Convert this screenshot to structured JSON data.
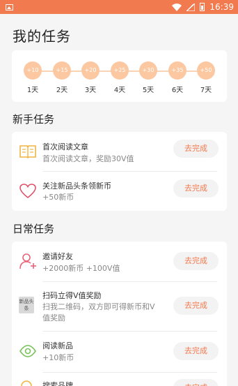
{
  "status_bar": {
    "time": "16:39"
  },
  "page_title": "我的任务",
  "checkin": {
    "days": [
      {
        "bonus": "+10",
        "label": "1天"
      },
      {
        "bonus": "+15",
        "label": "2天"
      },
      {
        "bonus": "+20",
        "label": "3天"
      },
      {
        "bonus": "+25",
        "label": "4天"
      },
      {
        "bonus": "+30",
        "label": "5天"
      },
      {
        "bonus": "+35",
        "label": "6天"
      },
      {
        "bonus": "+50",
        "label": "7天"
      }
    ]
  },
  "newbie": {
    "title": "新手任务",
    "tasks": [
      {
        "icon": "book-icon",
        "title": "首次阅读文章",
        "desc": "首次阅读文章，奖励30V值",
        "button": "去完成"
      },
      {
        "icon": "heart-icon",
        "title": "关注新品头条领新币",
        "desc": "+50新币",
        "button": "去完成"
      }
    ]
  },
  "daily": {
    "title": "日常任务",
    "tasks": [
      {
        "icon": "add-user-icon",
        "title": "邀请好友",
        "desc": "+2000新币 +100V值",
        "button": "去完成"
      },
      {
        "icon": "app-logo-icon",
        "logo_text": "新品头条",
        "title": "扫码立得V值奖励",
        "desc": "扫我二维码，双方即可得新币和V值奖励",
        "button": "去完成"
      },
      {
        "icon": "eye-icon",
        "title": "阅读新品",
        "desc": "+10新币",
        "button": "去完成"
      },
      {
        "icon": "search-icon",
        "title": "搜索品牌",
        "desc": "",
        "button": "去完成"
      }
    ]
  },
  "colors": {
    "accent": "#f27a4f",
    "bubble": "#fbc8a2",
    "button_bg": "#f3f3f3"
  }
}
